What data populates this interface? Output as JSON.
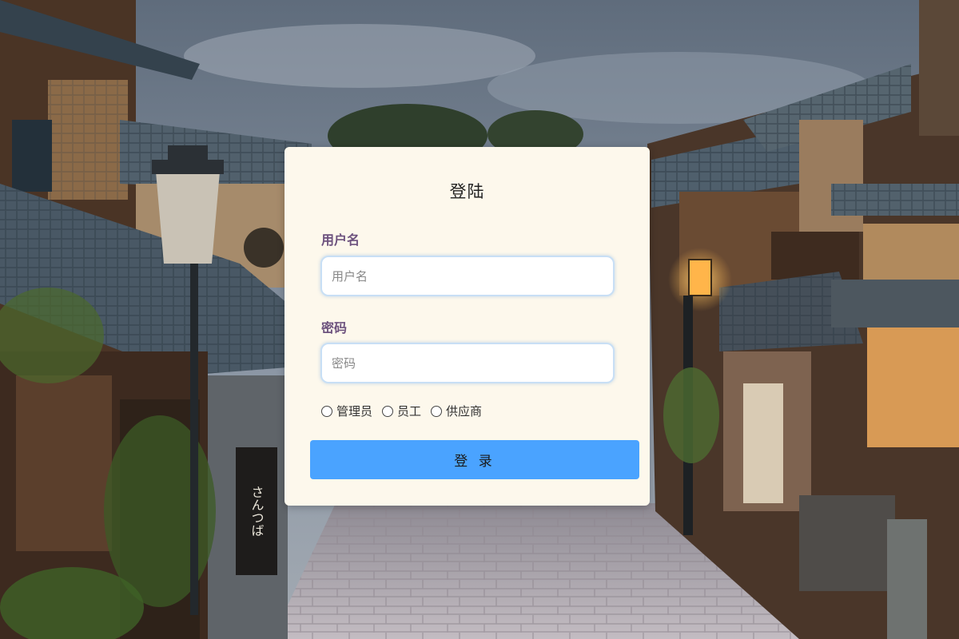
{
  "login": {
    "title": "登陆",
    "username_label": "用户名",
    "username_placeholder": "用户名",
    "username_value": "",
    "password_label": "密码",
    "password_placeholder": "密码",
    "password_value": "",
    "roles": [
      "管理员",
      "员工",
      "供应商"
    ],
    "submit_label": "登 录"
  },
  "background": {
    "scene": "Kyoto street, evening",
    "sign_text": "さんつば",
    "colors": {
      "sky": "#7d8a99",
      "roof": "#4c5c6a",
      "wood": "#5a3d2a",
      "lamp": "#ffb54a",
      "path": "#b9b2b8"
    }
  },
  "colors": {
    "card_bg": "#fdf8ec",
    "label": "#6d527e",
    "button": "#4aa3ff",
    "input_border": "#c8dff5"
  }
}
